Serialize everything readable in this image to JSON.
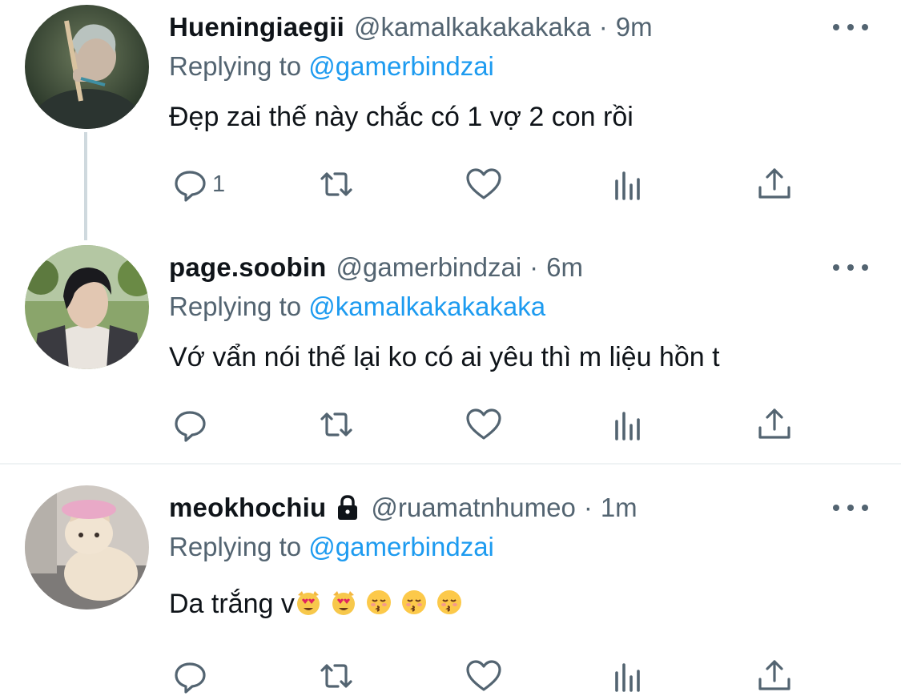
{
  "tweets": [
    {
      "display_name": "Hueningiaegii",
      "handle": "@kamalkakakakaka",
      "dot": "·",
      "time": "9m",
      "replying_prefix": "Replying to",
      "replying_to": "@gamerbindzai",
      "text": "Đẹp zai thế này chắc có 1 vợ 2 con rồi",
      "reply_count": "1"
    },
    {
      "display_name": "page.soobin",
      "handle": "@gamerbindzai",
      "dot": "·",
      "time": "6m",
      "replying_prefix": "Replying to",
      "replying_to": "@kamalkakakakaka",
      "text": "Vớ vẩn nói thế lại ko có ai yêu thì m liệu hồn t",
      "reply_count": ""
    },
    {
      "display_name": "meokhochiu",
      "handle": "@ruamatnhumeo",
      "dot": "·",
      "time": "1m",
      "replying_prefix": "Replying to",
      "replying_to": "@gamerbindzai",
      "text": "Da trắng v",
      "reply_count": "",
      "emojis": [
        "heart-eyes-cat",
        "heart-eyes-cat",
        "kissing-face",
        "kissing-face",
        "kissing-face"
      ]
    }
  ],
  "icons": {
    "reply": "reply-icon",
    "retweet": "retweet-icon",
    "like": "heart-icon",
    "analytics": "analytics-icon",
    "share": "share-icon",
    "more": "more-icon",
    "lock": "lock-icon"
  },
  "colors": {
    "link": "#1d9bf0",
    "secondary_text": "#536471",
    "primary_text": "#0f1419",
    "thread_line": "#cfd9de"
  }
}
